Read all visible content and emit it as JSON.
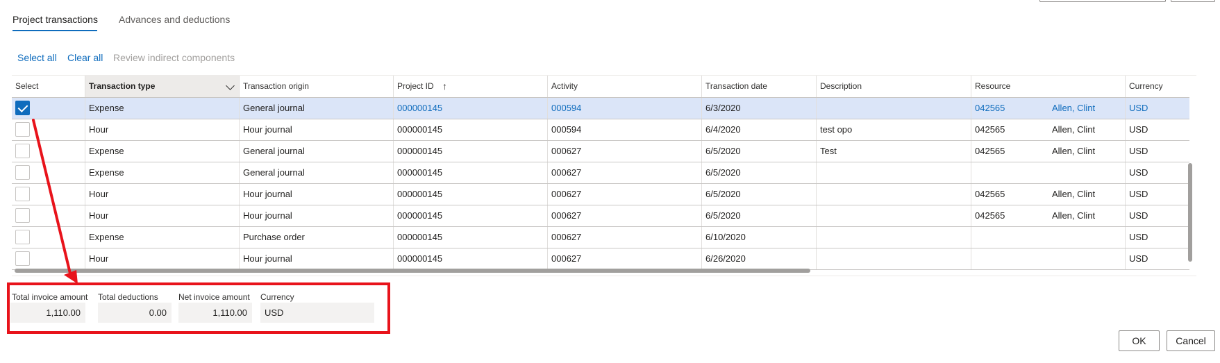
{
  "tabs": [
    {
      "label": "Project transactions",
      "active": true
    },
    {
      "label": "Advances and deductions",
      "active": false
    }
  ],
  "actions": {
    "select_all": "Select all",
    "clear_all": "Clear all",
    "review_indirect": "Review indirect components"
  },
  "grid": {
    "columns": [
      "Select",
      "Transaction type",
      "Transaction origin",
      "Project ID",
      "Activity",
      "Transaction date",
      "Description",
      "Resource",
      "Currency"
    ],
    "sort_indicator": "↑",
    "rows": [
      {
        "selected": true,
        "type": "Expense",
        "origin": "General journal",
        "project_id": "000000145",
        "activity": "000594",
        "date": "6/3/2020",
        "description": "",
        "resource_id": "042565",
        "resource_name": "Allen, Clint",
        "currency": "USD"
      },
      {
        "selected": false,
        "type": "Hour",
        "origin": "Hour journal",
        "project_id": "000000145",
        "activity": "000594",
        "date": "6/4/2020",
        "description": "test opo",
        "resource_id": "042565",
        "resource_name": "Allen, Clint",
        "currency": "USD"
      },
      {
        "selected": false,
        "type": "Expense",
        "origin": "General journal",
        "project_id": "000000145",
        "activity": "000627",
        "date": "6/5/2020",
        "description": "Test",
        "resource_id": "042565",
        "resource_name": "Allen, Clint",
        "currency": "USD"
      },
      {
        "selected": false,
        "type": "Expense",
        "origin": "General journal",
        "project_id": "000000145",
        "activity": "000627",
        "date": "6/5/2020",
        "description": "",
        "resource_id": "",
        "resource_name": "",
        "currency": "USD"
      },
      {
        "selected": false,
        "type": "Hour",
        "origin": "Hour journal",
        "project_id": "000000145",
        "activity": "000627",
        "date": "6/5/2020",
        "description": "",
        "resource_id": "042565",
        "resource_name": "Allen, Clint",
        "currency": "USD"
      },
      {
        "selected": false,
        "type": "Hour",
        "origin": "Hour journal",
        "project_id": "000000145",
        "activity": "000627",
        "date": "6/5/2020",
        "description": "",
        "resource_id": "042565",
        "resource_name": "Allen, Clint",
        "currency": "USD"
      },
      {
        "selected": false,
        "type": "Expense",
        "origin": "Purchase order",
        "project_id": "000000145",
        "activity": "000627",
        "date": "6/10/2020",
        "description": "",
        "resource_id": "",
        "resource_name": "",
        "currency": "USD"
      },
      {
        "selected": false,
        "type": "Hour",
        "origin": "Hour journal",
        "project_id": "000000145",
        "activity": "000627",
        "date": "6/26/2020",
        "description": "",
        "resource_id": "",
        "resource_name": "",
        "currency": "USD"
      }
    ]
  },
  "totals": {
    "total_invoice_label": "Total invoice amount",
    "total_invoice_value": "1,110.00",
    "total_deductions_label": "Total deductions",
    "total_deductions_value": "0.00",
    "net_invoice_label": "Net invoice amount",
    "net_invoice_value": "1,110.00",
    "currency_label": "Currency",
    "currency_value": "USD"
  },
  "buttons": {
    "ok": "OK",
    "cancel": "Cancel"
  },
  "colors": {
    "accent": "#0f6cbd",
    "highlight": "#e8131b",
    "selected_row": "#dbe5f8"
  }
}
